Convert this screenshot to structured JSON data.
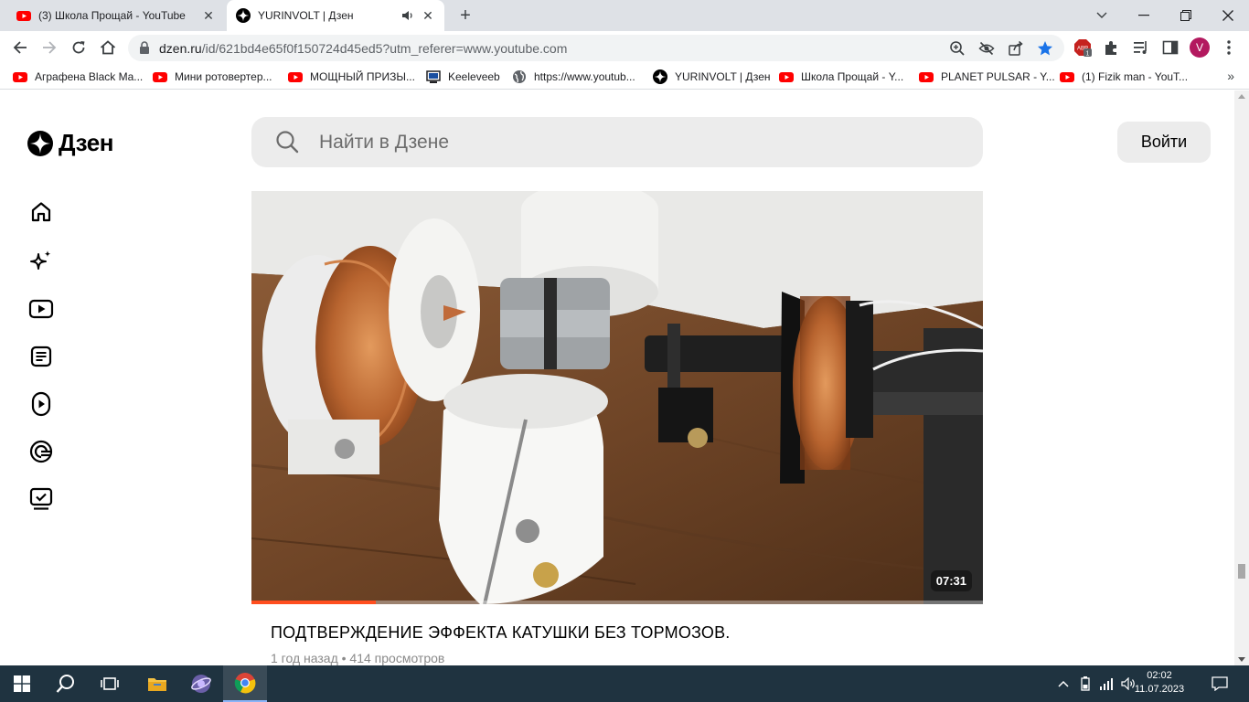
{
  "browser": {
    "tabs": [
      {
        "title": "(3) Школа Прощай - YouTube",
        "favicon": "youtube-icon",
        "active": false
      },
      {
        "title": "YURINVOLT | Дзен",
        "favicon": "dzen-icon",
        "active": true
      }
    ],
    "address": {
      "host": "dzen.ru",
      "path": "/id/621bd4e65f0f150724d45ed5?utm_referer=www.youtube.com"
    },
    "profile_initial": "V",
    "ext_badge": "1",
    "adblock_label": "ABP",
    "bookmarks": [
      {
        "label": "Аграфена Black Ma...",
        "icon": "youtube-icon"
      },
      {
        "label": "Мини ротовертер...",
        "icon": "youtube-icon"
      },
      {
        "label": "МОЩНЫЙ ПРИЗЫ...",
        "icon": "youtube-icon"
      },
      {
        "label": "Keeleveeb",
        "icon": "keeleveeb-icon"
      },
      {
        "label": "https://www.youtub...",
        "icon": "globe-icon"
      },
      {
        "label": "YURINVOLT | Дзен",
        "icon": "dzen-icon"
      },
      {
        "label": "Школа Прощай - Y...",
        "icon": "youtube-icon"
      },
      {
        "label": "PLANET PULSAR - Y...",
        "icon": "youtube-icon"
      },
      {
        "label": "(1) Fizik man - YouT...",
        "icon": "youtube-icon"
      }
    ],
    "bookmarks_more": "»"
  },
  "page": {
    "logo_text": "Дзен",
    "search_placeholder": "Найти в Дзене",
    "login_label": "Войти",
    "sidebar": [
      {
        "name": "home-icon"
      },
      {
        "name": "sparkle-icon"
      },
      {
        "name": "video-icon"
      },
      {
        "name": "article-icon"
      },
      {
        "name": "shorts-icon"
      },
      {
        "name": "subscriptions-icon"
      },
      {
        "name": "tv-check-icon"
      }
    ],
    "video": {
      "duration": "07:31",
      "progress_percent": 17,
      "title": "ПОДТВЕРЖДЕНИЕ ЭФФЕКТА КАТУШКИ БЕЗ ТОРМОЗОВ.",
      "meta": "1 год назад • 414 просмотров"
    }
  },
  "taskbar": {
    "clock_time": "02:02",
    "clock_date": "11.07.2023"
  },
  "colors": {
    "accent": "#ff4e1f",
    "taskbar": "#1f3340",
    "tabstrip": "#dee1e6"
  }
}
